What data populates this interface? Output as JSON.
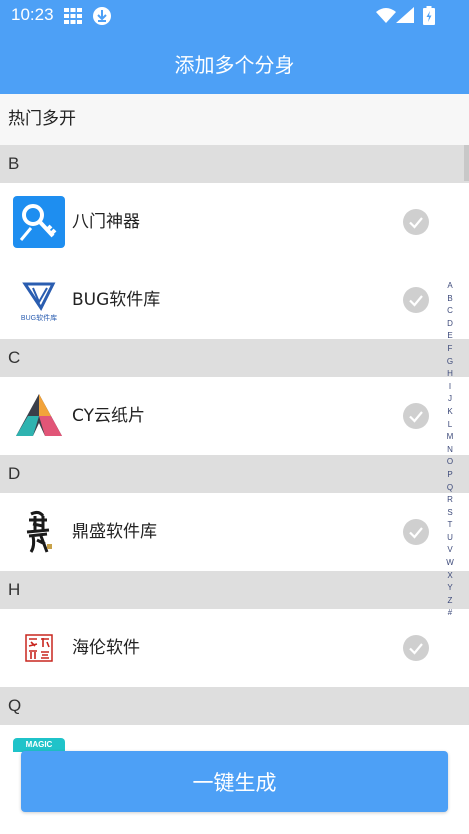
{
  "status_bar": {
    "time": "10:23"
  },
  "header": {
    "title": "添加多个分身"
  },
  "hot_label": "热门多开",
  "sections": [
    {
      "letter": "B",
      "apps": [
        {
          "name": "八门神器",
          "icon": "key-icon"
        },
        {
          "name": "BUG软件库",
          "icon": "bug-logo-icon"
        }
      ]
    },
    {
      "letter": "C",
      "apps": [
        {
          "name": "CY云纸片",
          "icon": "cy-triangle-icon"
        }
      ]
    },
    {
      "letter": "D",
      "apps": [
        {
          "name": "鼎盛软件库",
          "icon": "dingsheng-calligraphy-icon"
        }
      ]
    },
    {
      "letter": "H",
      "apps": [
        {
          "name": "海伦软件",
          "icon": "hailun-seal-icon"
        }
      ]
    },
    {
      "letter": "Q",
      "apps": []
    }
  ],
  "peek_icon_text": "MAGIC",
  "index_letters": [
    "A",
    "B",
    "C",
    "D",
    "E",
    "F",
    "G",
    "H",
    "I",
    "J",
    "K",
    "L",
    "M",
    "N",
    "O",
    "P",
    "Q",
    "R",
    "S",
    "T",
    "U",
    "V",
    "W",
    "X",
    "Y",
    "Z",
    "#"
  ],
  "generate_button": "一键生成",
  "colors": {
    "primary": "#4da0f6",
    "section_bg": "#dedede",
    "check_gray": "#cfcfcf"
  }
}
